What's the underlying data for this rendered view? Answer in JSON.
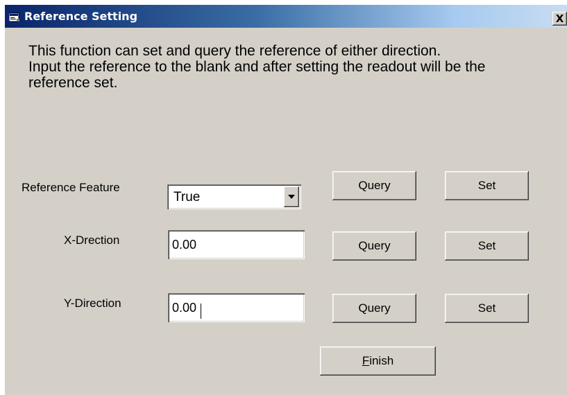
{
  "window": {
    "title": "Reference Setting",
    "close_label": "X"
  },
  "description": {
    "line1": "This function can set and query the reference of either direction.",
    "line2": "Input the reference to the blank and after setting the readout will be the reference set."
  },
  "reference_feature": {
    "label": "Reference Feature",
    "selected": "True",
    "query_label": "Query",
    "set_label": "Set"
  },
  "x_direction": {
    "label": "X-Drection",
    "value": "0.00",
    "query_label": "Query",
    "set_label": "Set"
  },
  "y_direction": {
    "label": "Y-Direction",
    "value": "0.00",
    "query_label": "Query",
    "set_label": "Set"
  },
  "finish": {
    "mnemonic": "F",
    "rest": "inish"
  }
}
